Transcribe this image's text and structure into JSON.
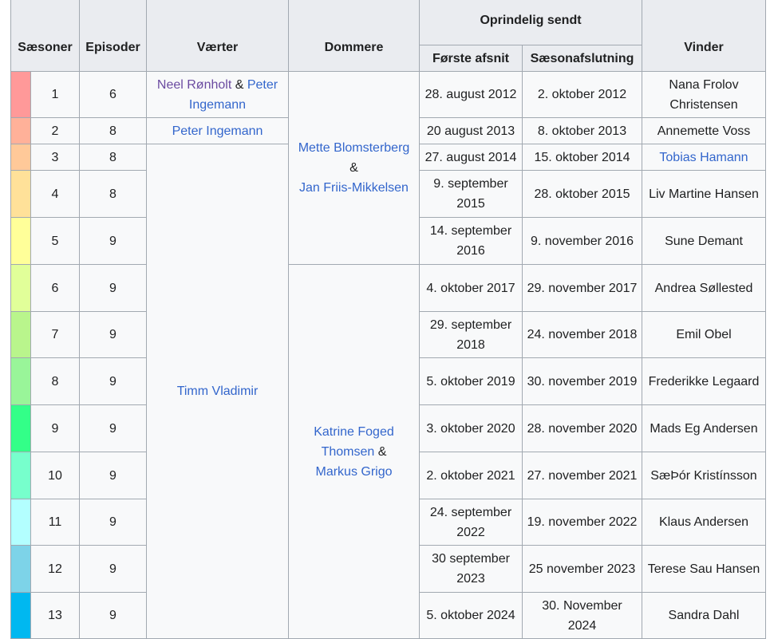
{
  "headers": {
    "seasons": "Sæsoner",
    "episodes": "Episoder",
    "hosts": "Værter",
    "judges": "Dommere",
    "original_aired": "Oprindelig sendt",
    "first_episode": "Første afsnit",
    "season_finale": "Sæsonafslutning",
    "winner": "Vinder"
  },
  "hosts": {
    "neel": "Neel Rønholt",
    "amp1": "&",
    "peter_part1": "Peter",
    "peter_part2": "Ingemann",
    "peter_full": "Peter Ingemann",
    "timm": "Timm Vladimir"
  },
  "judges": {
    "mette": "Mette Blomsterberg",
    "amp1": "&",
    "jan": "Jan Friis-Mikkelsen",
    "katrine_part1": "Katrine Foged",
    "katrine_part2": "Thomsen",
    "amp2": "&",
    "markus": "Markus Grigo"
  },
  "rows": [
    {
      "color": "#ff9999",
      "season": "1",
      "episodes": "6",
      "first": "28. august 2012",
      "finale": "2. oktober 2012",
      "winner": "Nana Frolov Christensen",
      "winner_link": false
    },
    {
      "color": "#ffb199",
      "season": "2",
      "episodes": "8",
      "first": "20 august 2013",
      "finale": "8. oktober 2013",
      "winner": "Annemette Voss",
      "winner_link": false
    },
    {
      "color": "#ffc999",
      "season": "3",
      "episodes": "8",
      "first": "27. august 2014",
      "finale": "15. oktober 2014",
      "winner": "Tobias Hamann",
      "winner_link": true
    },
    {
      "color": "#ffe199",
      "season": "4",
      "episodes": "8",
      "first": "9. september 2015",
      "finale": "28. oktober 2015",
      "winner": "Liv Martine Hansen",
      "winner_link": false
    },
    {
      "color": "#ffff99",
      "season": "5",
      "episodes": "9",
      "first": "14. september 2016",
      "finale": "9. november 2016",
      "winner": "Sune Demant",
      "winner_link": false
    },
    {
      "color": "#e1ff99",
      "season": "6",
      "episodes": "9",
      "first": "4. oktober 2017",
      "finale": "29. november 2017",
      "winner": "Andrea Søllested",
      "winner_link": false
    },
    {
      "color": "#b9f58c",
      "season": "7",
      "episodes": "9",
      "first": "29. september 2018",
      "finale": "24. november 2018",
      "winner": "Emil Obel",
      "winner_link": false
    },
    {
      "color": "#99f599",
      "season": "8",
      "episodes": "9",
      "first": "5. oktober 2019",
      "finale": "30. november 2019",
      "winner": "Frederikke Legaard",
      "winner_link": false
    },
    {
      "color": "#33ff88",
      "season": "9",
      "episodes": "9",
      "first": "3. oktober 2020",
      "finale": "28. november 2020",
      "winner": "Mads Eg Andersen",
      "winner_link": false
    },
    {
      "color": "#77ffcc",
      "season": "10",
      "episodes": "9",
      "first": "2. oktober 2021",
      "finale": "27. november 2021",
      "winner": "SæÞór Kristínsson",
      "winner_link": false
    },
    {
      "color": "#b3ffff",
      "season": "11",
      "episodes": "9",
      "first": "24. september 2022",
      "finale": "19. november 2022",
      "winner": "Klaus Andersen",
      "winner_link": false
    },
    {
      "color": "#7dd3e8",
      "season": "12",
      "episodes": "9",
      "first": "30 september 2023",
      "finale": "25 november 2023",
      "winner": "Terese Sau Hansen",
      "winner_link": false
    },
    {
      "color": "#00b8f0",
      "season": "13",
      "episodes": "9",
      "first": "5. oktober 2024",
      "finale": "30. November 2024",
      "winner": "Sandra Dahl",
      "winner_link": false
    }
  ]
}
